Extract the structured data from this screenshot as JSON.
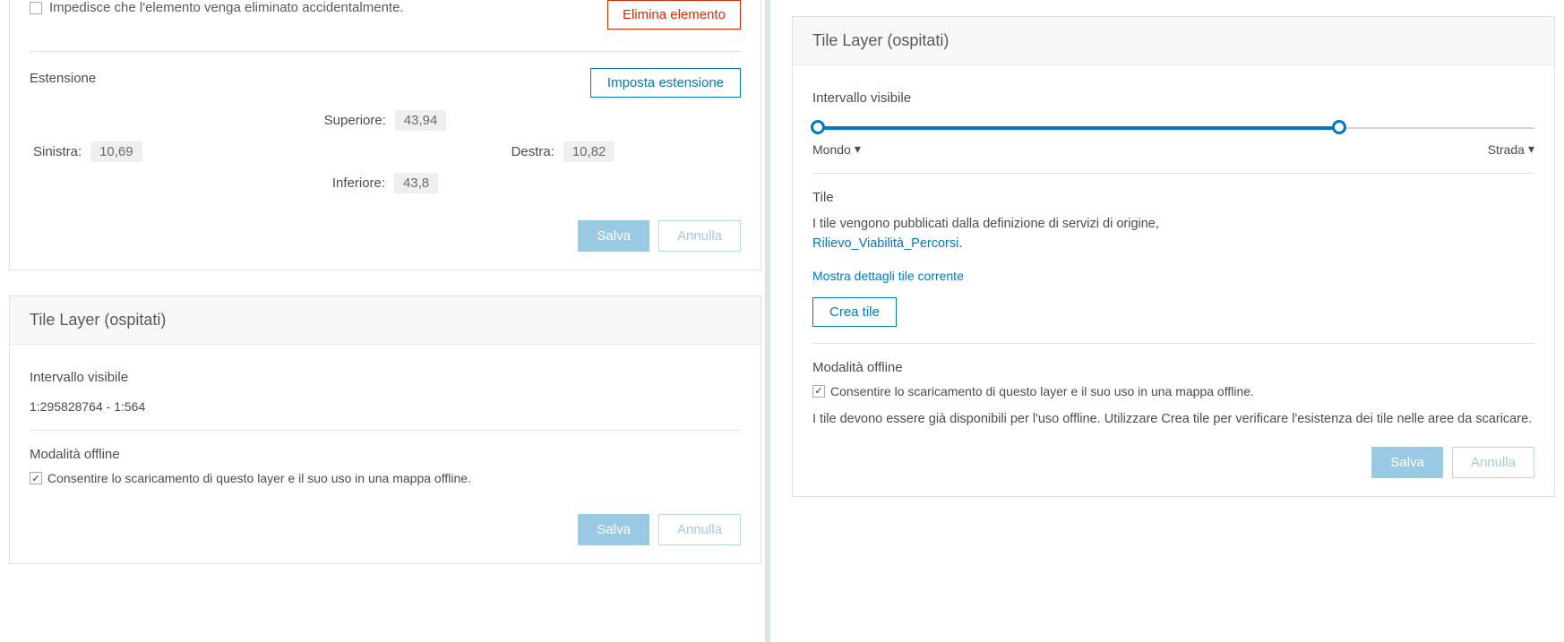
{
  "left": {
    "deleteProtect": {
      "checked": false,
      "label": "Impedisce che l'elemento venga eliminato accidentalmente."
    },
    "deleteBtn": "Elimina elemento",
    "extent": {
      "title": "Estensione",
      "setBtn": "Imposta estensione",
      "topLabel": "Superiore:",
      "topVal": "43,94",
      "leftLabel": "Sinistra:",
      "leftVal": "10,69",
      "rightLabel": "Destra:",
      "rightVal": "10,82",
      "bottomLabel": "Inferiore:",
      "bottomVal": "43,8"
    },
    "save": "Salva",
    "cancel": "Annulla",
    "tilePanel": {
      "header": "Tile Layer (ospitati)",
      "visibleRangeTitle": "Intervallo visibile",
      "visibleRangeValue": "1:295828764 - 1:564",
      "offlineTitle": "Modalità offline",
      "offlineChecked": true,
      "offlineLabel": "Consentire lo scaricamento di questo layer e il suo uso in una mappa offline."
    }
  },
  "right": {
    "tilePanel": {
      "header": "Tile Layer (ospitati)",
      "visibleRangeTitle": "Intervallo visibile",
      "slider": {
        "minLabel": "Mondo",
        "maxLabel": "Strada"
      },
      "tileTitle": "Tile",
      "tileText": "I tile vengono pubblicati dalla definizione di servizi di origine,",
      "tileLink": "Rilievo_Viabilità_Percorsi",
      "tileLinkSuffix": ".",
      "showDetails": "Mostra dettagli tile corrente",
      "createBtn": "Crea tile",
      "offlineTitle": "Modalità offline",
      "offlineChecked": true,
      "offlineLabel": "Consentire lo scaricamento di questo layer e il suo uso in una mappa offline.",
      "offlineNote": "I tile devono essere già disponibili per l'uso offline. Utilizzare Crea tile per verificare l'esistenza dei tile nelle aree da scaricare."
    },
    "save": "Salva",
    "cancel": "Annulla"
  }
}
